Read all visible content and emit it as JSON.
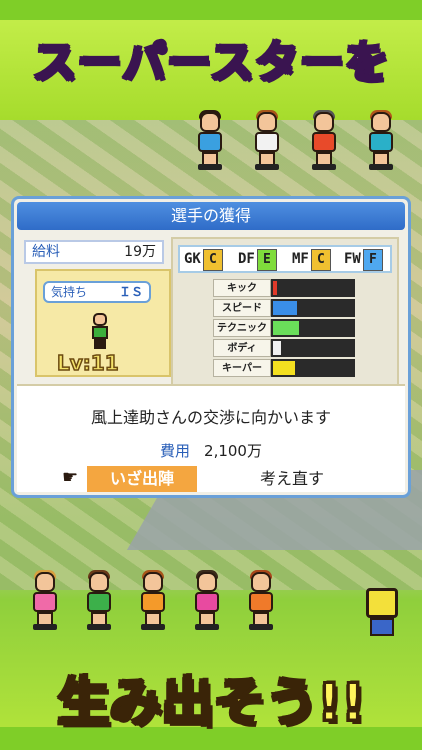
{
  "headline": "スーパースターを",
  "tagline": "生み出そう!!",
  "panel": {
    "title": "選手の獲得",
    "salary_label": "給料",
    "salary_value": "19万",
    "mood_label": "気持ち",
    "mood_value": "ＩＳ",
    "level": "Lv:11",
    "positions": [
      {
        "pos": "GK",
        "grade": "C",
        "color": "#f0c030"
      },
      {
        "pos": "DF",
        "grade": "E",
        "color": "#7fdc3c"
      },
      {
        "pos": "MF",
        "grade": "C",
        "color": "#f0c030"
      },
      {
        "pos": "FW",
        "grade": "F",
        "color": "#4fa8f0"
      }
    ],
    "stats": [
      {
        "label": "キック",
        "level": 0.05,
        "color": "#e03a2a"
      },
      {
        "label": "スピード",
        "level": 0.3,
        "color": "#3a8ee8"
      },
      {
        "label": "テクニック",
        "level": 0.32,
        "color": "#6ade5a"
      },
      {
        "label": "ボディ",
        "level": 0.1,
        "color": "#f0f0f0"
      },
      {
        "label": "キーパー",
        "level": 0.28,
        "color": "#f4e020"
      }
    ],
    "message": "風上達助さんの交渉に向かいます",
    "cost_label": "費用",
    "cost_value": "2,100万",
    "go_button": "いざ出陣",
    "back_button": "考え直す"
  }
}
